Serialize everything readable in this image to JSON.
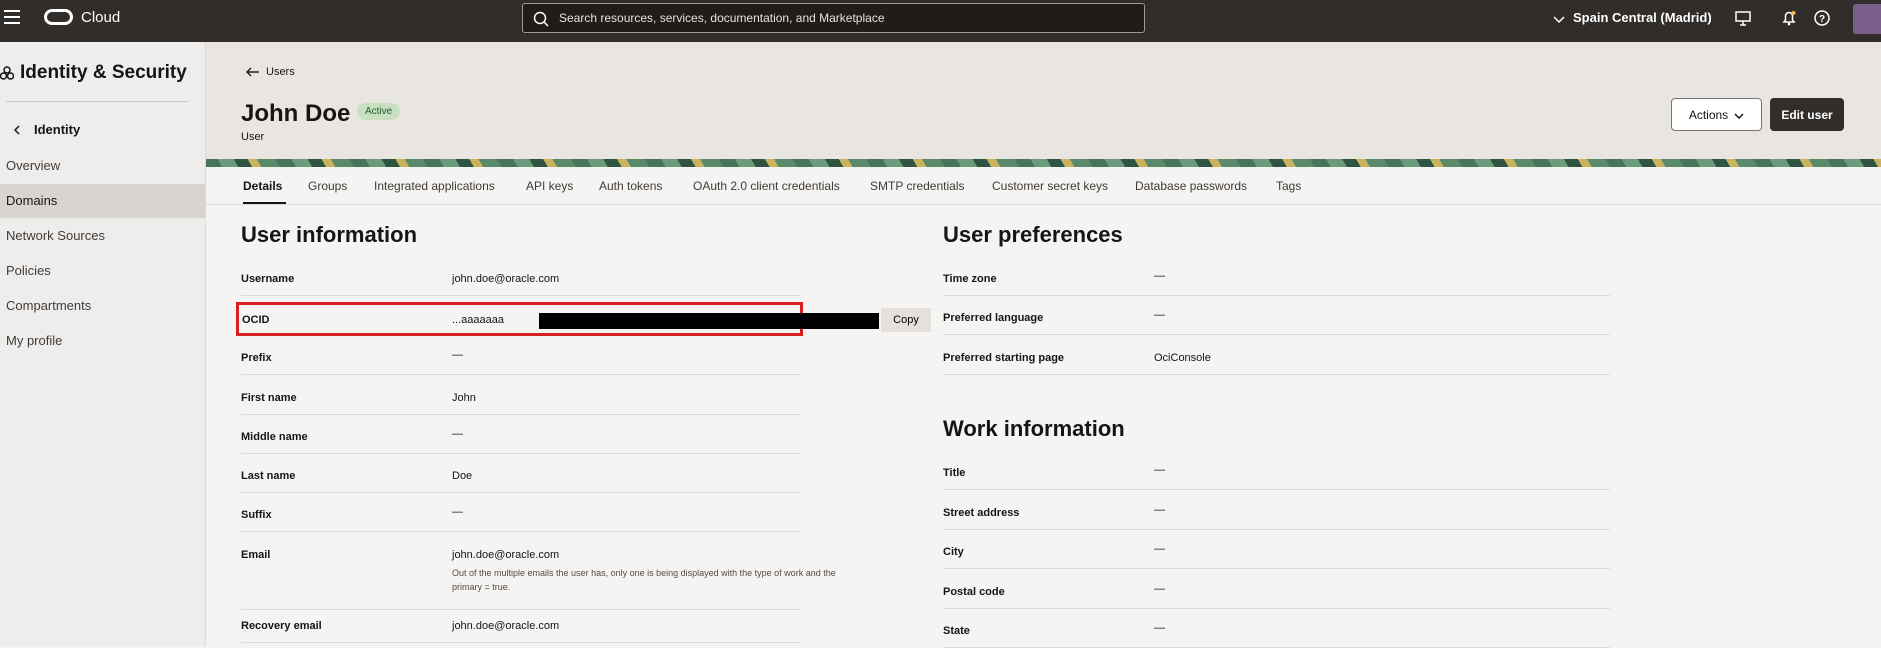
{
  "topbar": {
    "brand": "Cloud",
    "search_placeholder": "Search resources, services, documentation, and Marketplace",
    "region": "Spain Central (Madrid)",
    "icons": [
      "menu-icon",
      "oracle-logo",
      "search-icon",
      "chevron-down-icon",
      "cloud-shell-icon",
      "bell-icon",
      "help-icon",
      "profile-avatar-icon"
    ]
  },
  "sidebar": {
    "title": "Identity & Security",
    "back_label": "Identity",
    "items": [
      {
        "label": "Overview",
        "active": false
      },
      {
        "label": "Domains",
        "active": true
      },
      {
        "label": "Network Sources",
        "active": false
      },
      {
        "label": "Policies",
        "active": false
      },
      {
        "label": "Compartments",
        "active": false
      },
      {
        "label": "My profile",
        "active": false
      }
    ]
  },
  "header": {
    "breadcrumb": "Users",
    "title": "John Doe",
    "status": "Active",
    "subtitle": "User",
    "actions_label": "Actions",
    "edit_label": "Edit user"
  },
  "tabs": [
    {
      "label": "Details",
      "active": true
    },
    {
      "label": "Groups"
    },
    {
      "label": "Integrated applications"
    },
    {
      "label": "API keys"
    },
    {
      "label": "Auth tokens"
    },
    {
      "label": "OAuth 2.0 client credentials"
    },
    {
      "label": "SMTP credentials"
    },
    {
      "label": "Customer secret keys"
    },
    {
      "label": "Database passwords"
    },
    {
      "label": "Tags"
    }
  ],
  "user_info": {
    "title": "User information",
    "rows": [
      {
        "label": "Username",
        "value": "john.doe@oracle.com"
      },
      {
        "label": "OCID",
        "value": "...aaaaaaa",
        "copy_label": "Copy"
      },
      {
        "label": "Prefix",
        "value": "—"
      },
      {
        "label": "First name",
        "value": "John"
      },
      {
        "label": "Middle name",
        "value": "—"
      },
      {
        "label": "Last name",
        "value": "Doe"
      },
      {
        "label": "Suffix",
        "value": "—"
      },
      {
        "label": "Email",
        "value": "john.doe@oracle.com",
        "note": "Out of the multiple emails the user has, only one is being displayed with the type of work and the primary = true."
      },
      {
        "label": "Recovery email",
        "value": "john.doe@oracle.com"
      }
    ]
  },
  "user_prefs": {
    "title": "User preferences",
    "rows": [
      {
        "label": "Time zone",
        "value": "—"
      },
      {
        "label": "Preferred language",
        "value": "—"
      },
      {
        "label": "Preferred starting page",
        "value": "OciConsole"
      }
    ]
  },
  "work_info": {
    "title": "Work information",
    "rows": [
      {
        "label": "Title",
        "value": "—"
      },
      {
        "label": "Street address",
        "value": "—"
      },
      {
        "label": "City",
        "value": "—"
      },
      {
        "label": "Postal code",
        "value": "—"
      },
      {
        "label": "State",
        "value": "—"
      }
    ]
  }
}
